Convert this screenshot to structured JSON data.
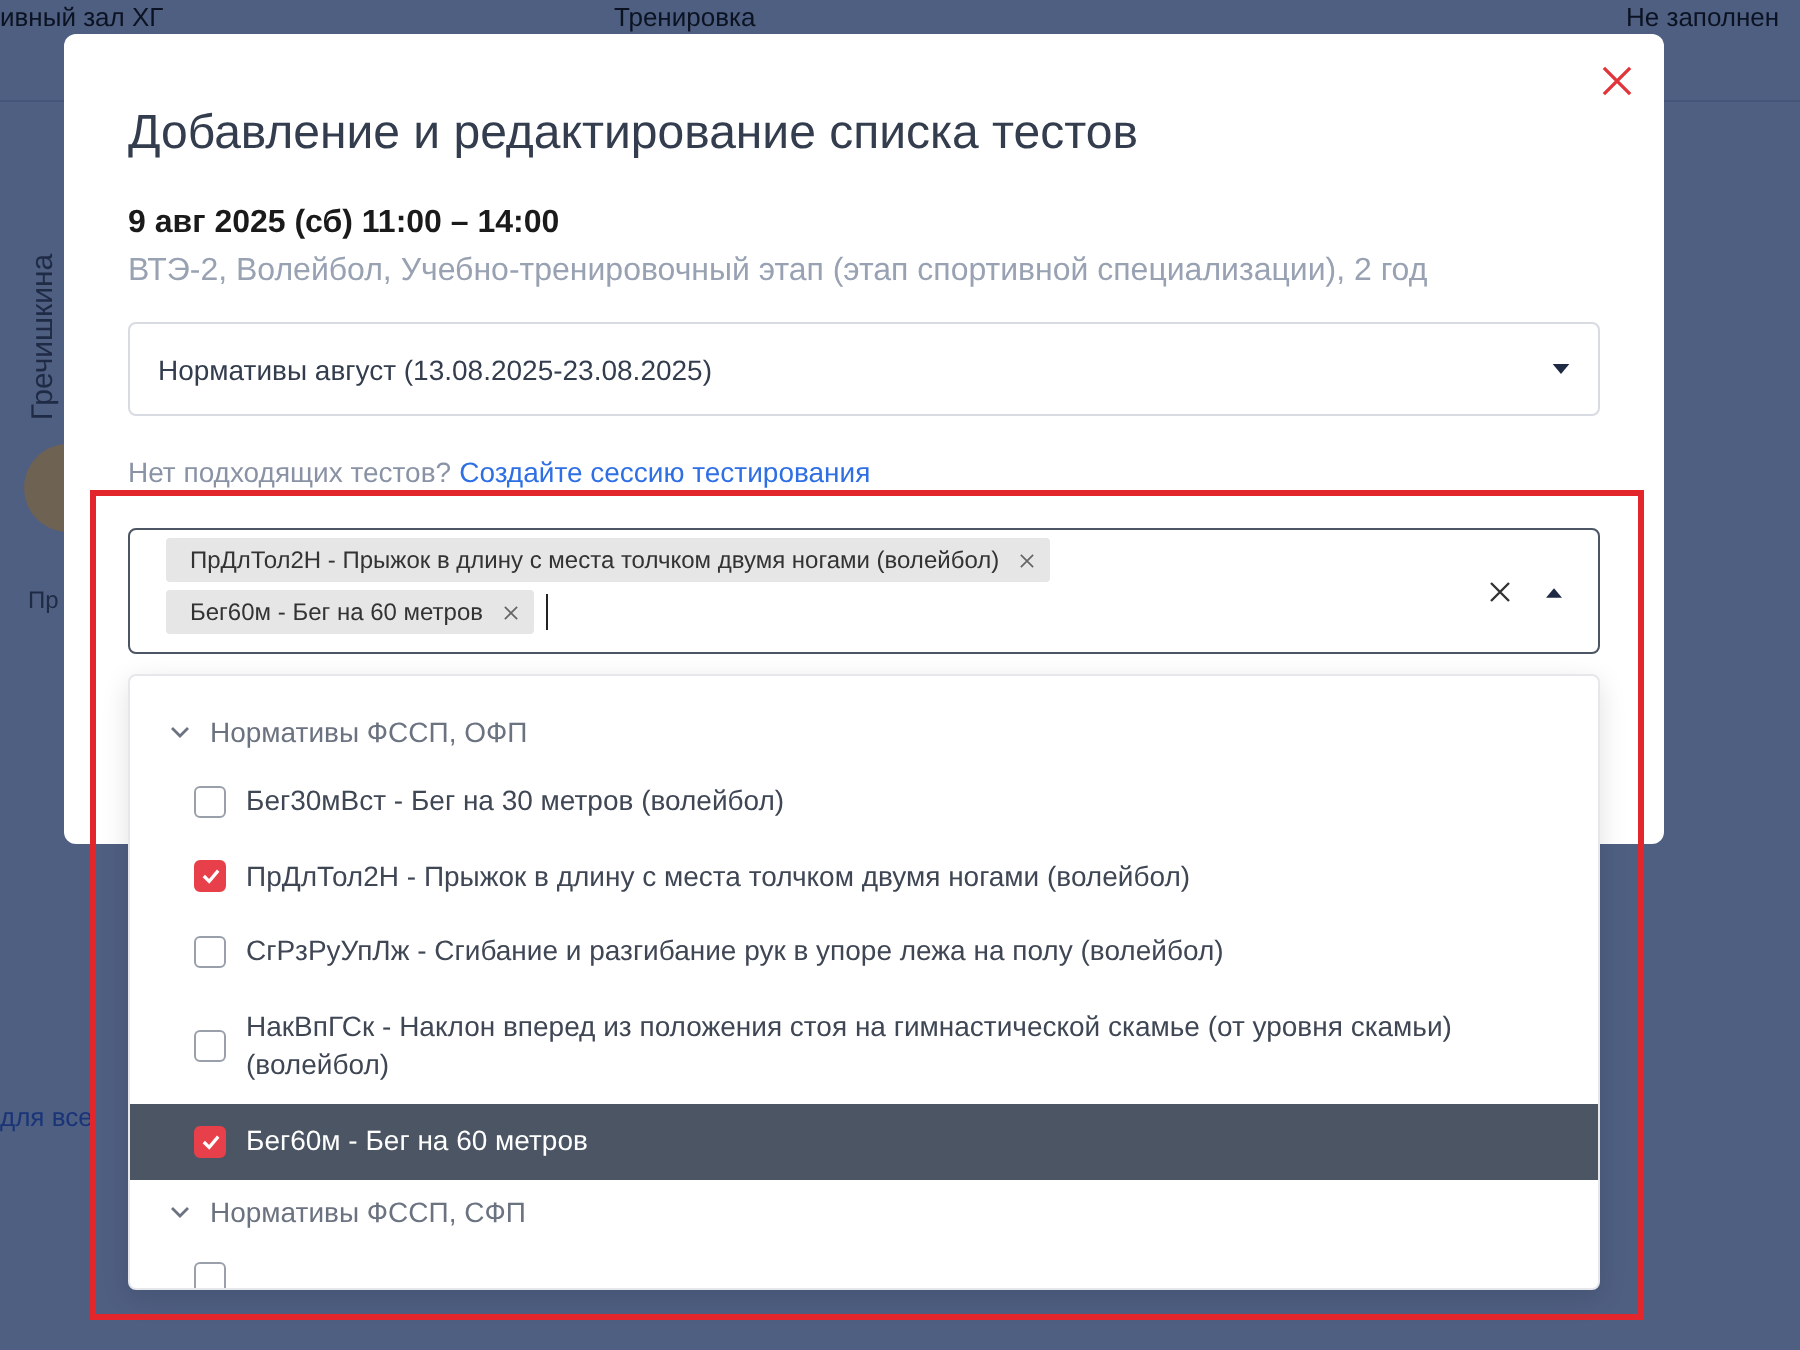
{
  "background": {
    "header_cells": [
      "ивный зал ХГ",
      "Тренировка",
      "Не заполнен"
    ],
    "person_name": "Гречишкина",
    "row_label": "Пр",
    "link_text": "для все"
  },
  "modal": {
    "title": "Добавление и редактирование списка тестов",
    "date": "9 авг 2025 (сб) 11:00 – 14:00",
    "subtitle": "ВТЭ-2, Волейбол, Учебно-тренировочный этап (этап спортивной специализации), 2 год",
    "session_select": {
      "value": "Нормативы август (13.08.2025-23.08.2025)"
    },
    "hint": "Нет подходящих тестов?",
    "hint_link": "Создайте сессию тестирования",
    "tests_select": {
      "expanded": true,
      "tags": [
        {
          "label": "ПрДлТол2Н - Прыжок в длину с места толчком двумя ногами (волейбол)"
        },
        {
          "label": "Бег60м - Бег на 60 метров"
        }
      ]
    },
    "dropdown": {
      "groups": [
        {
          "title": "Нормативы ФССП, ОФП",
          "expanded": true,
          "items": [
            {
              "label": "Бег30мВст - Бег на 30 метров (волейбол)",
              "checked": false,
              "highlighted": false
            },
            {
              "label": "ПрДлТол2Н - Прыжок в длину с места толчком двумя ногами (волейбол)",
              "checked": true,
              "highlighted": false
            },
            {
              "label": "СгРзРуУпЛж - Сгибание и разгибание рук в упоре лежа на полу (волейбол)",
              "checked": false,
              "highlighted": false
            },
            {
              "label": "НакВпГСк - Наклон вперед из положения стоя на гимнастической скамье (от уровня скамьи) (волейбол)",
              "checked": false,
              "highlighted": false
            },
            {
              "label": "Бег60м - Бег на 60 метров",
              "checked": true,
              "highlighted": true
            }
          ]
        },
        {
          "title": "Нормативы ФССП, СФП",
          "expanded": true
        }
      ]
    }
  }
}
